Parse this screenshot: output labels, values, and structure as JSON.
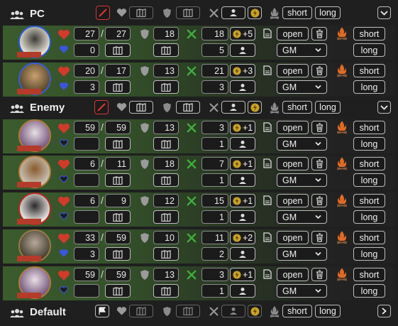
{
  "groups": [
    {
      "title": "PC",
      "header": {
        "short": "short",
        "long": "long"
      },
      "rows": [
        {
          "hp": "27",
          "hp_max": "27",
          "ac": "18",
          "init": "18",
          "bonus": "+5",
          "temp": "0",
          "mod": "5",
          "open": "open",
          "vis": "GM",
          "short": "short",
          "long": "long",
          "portrait": "portrait-knight",
          "ring": "#2d5bd6"
        },
        {
          "hp": "20",
          "hp_max": "17",
          "ac": "13",
          "init": "21",
          "bonus": "+3",
          "temp": "3",
          "mod": "3",
          "open": "open",
          "vis": "GM",
          "short": "short",
          "long": "long",
          "portrait": "portrait-brute",
          "ring": "#3a5cd8"
        }
      ]
    },
    {
      "title": "Enemy",
      "header": {
        "short": "short",
        "long": "long"
      },
      "rows": [
        {
          "hp": "59",
          "hp_max": "59",
          "ac": "13",
          "init": "3",
          "bonus": "+1",
          "temp": "",
          "mod": "1",
          "open": "open",
          "vis": "GM",
          "short": "short",
          "long": "long",
          "portrait": "portrait-elf",
          "ring": "#b07a3a"
        },
        {
          "hp": "6",
          "hp_max": "11",
          "ac": "18",
          "init": "7",
          "bonus": "+1",
          "temp": "",
          "mod": "1",
          "open": "open",
          "vis": "GM",
          "short": "short",
          "long": "long",
          "portrait": "portrait-horned",
          "ring": "#b07a3a"
        },
        {
          "hp": "6",
          "hp_max": "9",
          "ac": "12",
          "init": "15",
          "bonus": "+1",
          "temp": "",
          "mod": "1",
          "open": "open",
          "vis": "GM",
          "short": "short",
          "long": "long",
          "portrait": "portrait-demon",
          "ring": "#b52a22"
        },
        {
          "hp": "33",
          "hp_max": "59",
          "ac": "10",
          "init": "11",
          "bonus": "+2",
          "temp": "3",
          "mod": "2",
          "open": "open",
          "vis": "GM",
          "short": "short",
          "long": "long",
          "portrait": "portrait-dwarf",
          "ring": "#9a7a45"
        },
        {
          "hp": "59",
          "hp_max": "59",
          "ac": "13",
          "init": "3",
          "bonus": "+1",
          "temp": "",
          "mod": "1",
          "open": "open",
          "vis": "GM",
          "short": "short",
          "long": "long",
          "portrait": "portrait-elf",
          "ring": "#b07a3a"
        }
      ]
    },
    {
      "title": "Default",
      "header": {
        "short": "short",
        "long": "long"
      },
      "rows": []
    }
  ],
  "colors": {
    "heart": "#d23a2a",
    "shield": "#9a9a9a",
    "sword": "#3fae3a",
    "bolt": "#c9a227",
    "fire": "#e06a25",
    "blue_heart": "#3a56e0"
  }
}
